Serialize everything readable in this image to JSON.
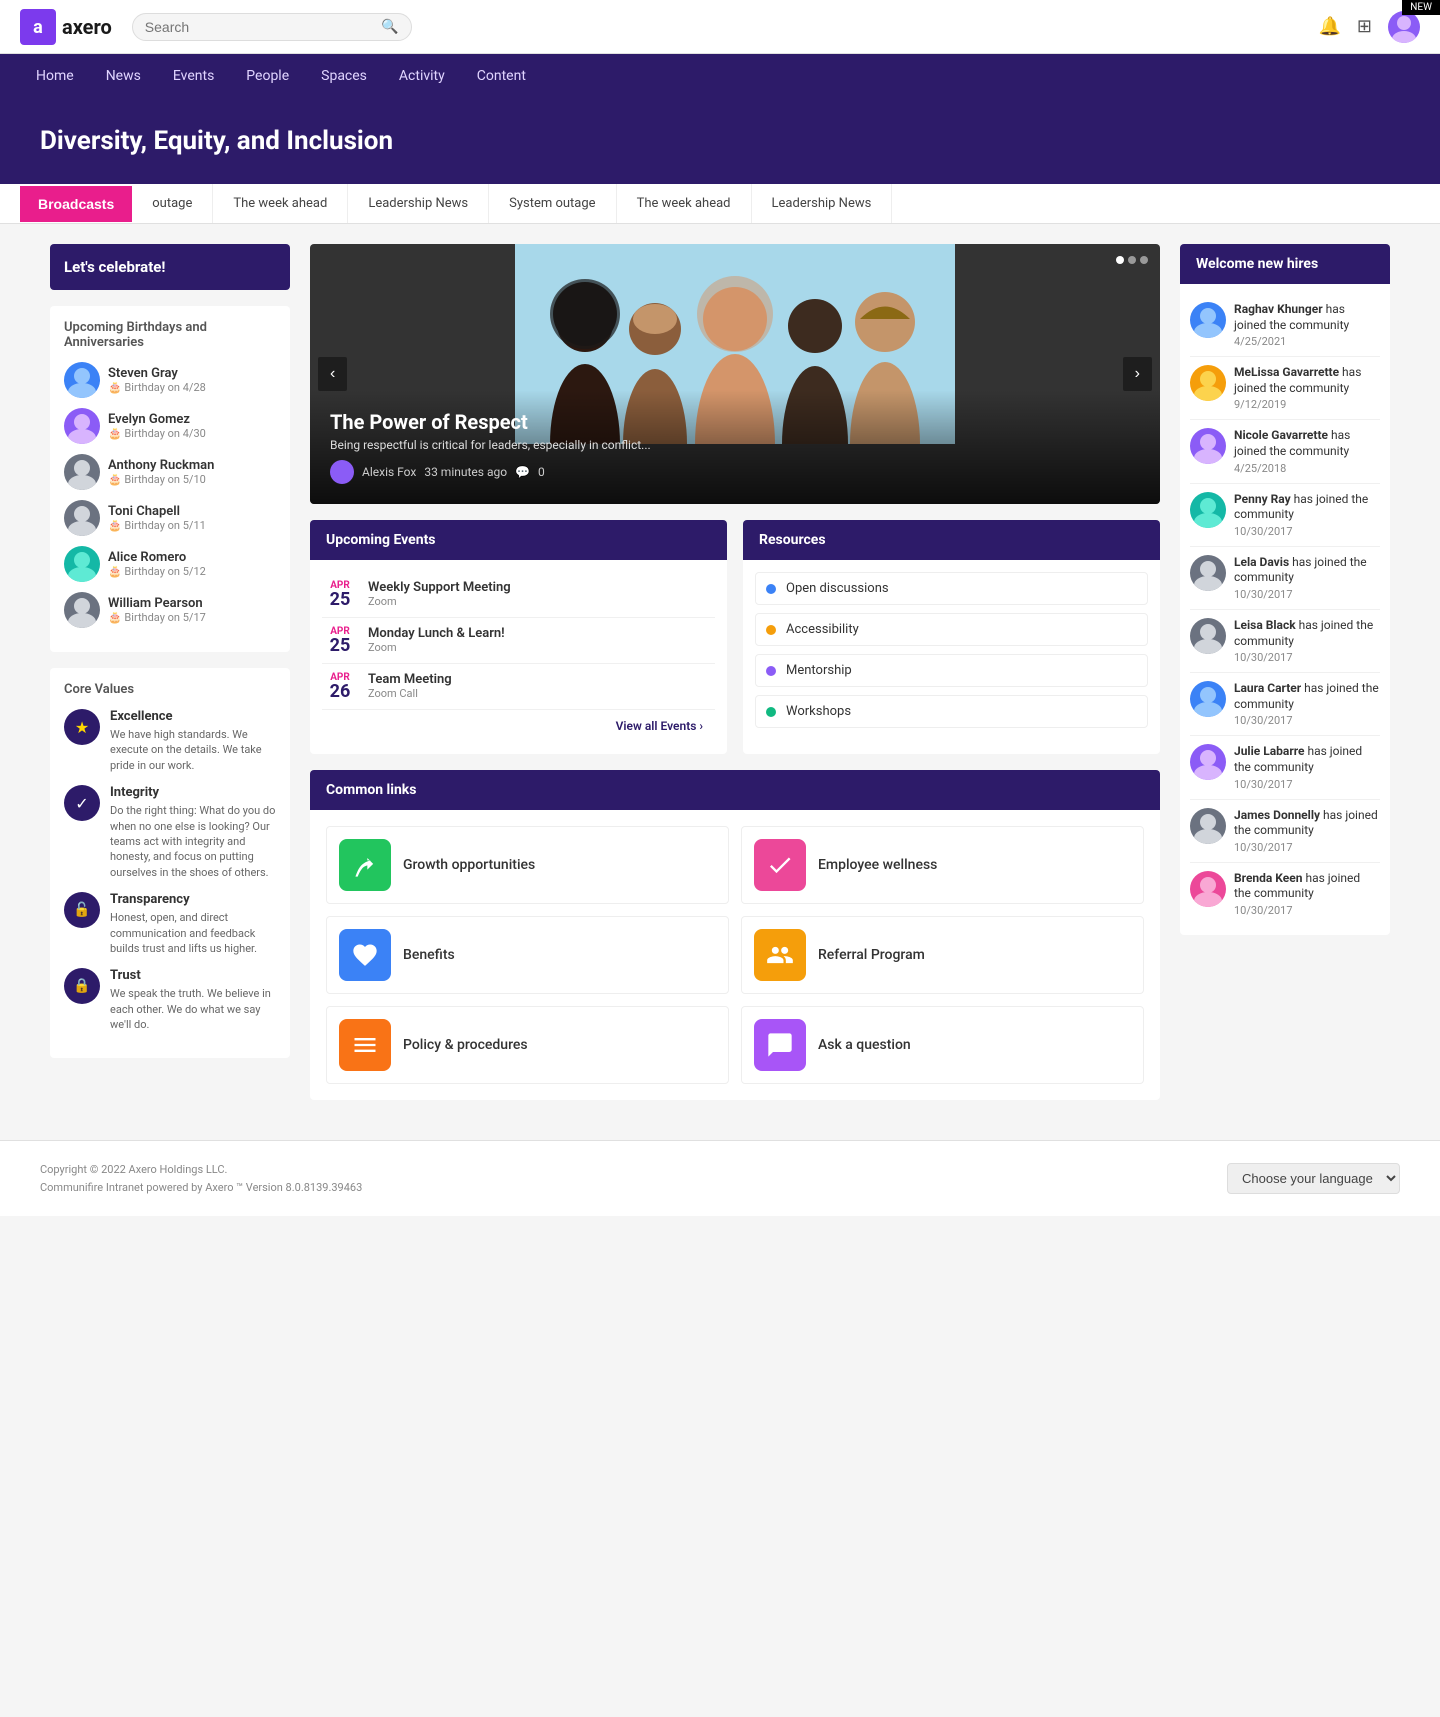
{
  "meta": {
    "corner_badge": "NEW"
  },
  "topbar": {
    "logo_text": "axero",
    "search_placeholder": "Search",
    "search_icon": "🔍"
  },
  "navbar": {
    "items": [
      {
        "label": "Home",
        "href": "#"
      },
      {
        "label": "News",
        "href": "#"
      },
      {
        "label": "Events",
        "href": "#"
      },
      {
        "label": "People",
        "href": "#"
      },
      {
        "label": "Spaces",
        "href": "#"
      },
      {
        "label": "Activity",
        "href": "#"
      },
      {
        "label": "Content",
        "href": "#"
      }
    ]
  },
  "page_header": {
    "title": "Diversity, Equity, and Inclusion"
  },
  "broadcasts_bar": {
    "button_label": "Broadcasts",
    "items": [
      {
        "label": "outage"
      },
      {
        "label": "The week ahead"
      },
      {
        "label": "Leadership News"
      },
      {
        "label": "System outage"
      },
      {
        "label": "The week ahead"
      },
      {
        "label": "Leadership News"
      }
    ]
  },
  "celebrate": {
    "title": "Let's celebrate!"
  },
  "birthdays": {
    "heading": "Upcoming Birthdays and Anniversaries",
    "items": [
      {
        "name": "Steven Gray",
        "event": "Birthday on 4/28",
        "color": "av-blue"
      },
      {
        "name": "Evelyn Gomez",
        "event": "Birthday on 4/30",
        "color": "av-purple"
      },
      {
        "name": "Anthony Ruckman",
        "event": "Birthday on 5/10",
        "color": "av-gray"
      },
      {
        "name": "Toni Chapell",
        "event": "Birthday on 5/11",
        "color": "av-gray"
      },
      {
        "name": "Alice Romero",
        "event": "Birthday on 5/12",
        "color": "av-teal"
      },
      {
        "name": "William Pearson",
        "event": "Birthday on 5/17",
        "color": "av-gray"
      }
    ]
  },
  "core_values": {
    "heading": "Core Values",
    "items": [
      {
        "title": "Excellence",
        "desc": "We have high standards. We execute on the details. We take pride in our work.",
        "icon": "★",
        "bg": "#2d1b69",
        "color": "#fff"
      },
      {
        "title": "Integrity",
        "desc": "Do the right thing: What do you do when no one else is looking? Our teams act with integrity and honesty, and focus on putting ourselves in the shoes of others.",
        "icon": "✓",
        "bg": "#2d1b69",
        "color": "#fff"
      },
      {
        "title": "Transparency",
        "desc": "Honest, open, and direct communication and feedback builds trust and lifts us higher.",
        "icon": "🔓",
        "bg": "#2d1b69",
        "color": "#fff"
      },
      {
        "title": "Trust",
        "desc": "We speak the truth. We believe in each other. We do what we say we'll do.",
        "icon": "🔒",
        "bg": "#2d1b69",
        "color": "#fff"
      }
    ]
  },
  "hero": {
    "title": "The Power of Respect",
    "subtitle": "Being respectful is critical for leaders, especially in conflict...",
    "author": "Alexis Fox",
    "time": "33 minutes ago",
    "comments": "0",
    "nav_left": "‹",
    "nav_right": "›"
  },
  "upcoming_events": {
    "heading": "Upcoming Events",
    "items": [
      {
        "month": "APR",
        "day": "25",
        "title": "Weekly Support Meeting",
        "location": "Zoom"
      },
      {
        "month": "APR",
        "day": "25",
        "title": "Monday Lunch & Learn!",
        "location": "Zoom"
      },
      {
        "month": "APR",
        "day": "26",
        "title": "Team Meeting",
        "location": "Zoom Call"
      }
    ],
    "view_all_label": "View all Events ›"
  },
  "resources": {
    "heading": "Resources",
    "items": [
      {
        "label": "Open discussions",
        "color": "#3B82F6"
      },
      {
        "label": "Accessibility",
        "color": "#F59E0B"
      },
      {
        "label": "Mentorship",
        "color": "#8B5CF6"
      },
      {
        "label": "Workshops",
        "color": "#10B981"
      }
    ]
  },
  "common_links": {
    "heading": "Common links",
    "items": [
      {
        "label": "Growth opportunities",
        "icon": "🌿",
        "bg": "#22C55E"
      },
      {
        "label": "Employee wellness",
        "icon": "✔",
        "bg": "#EC4899"
      },
      {
        "label": "Benefits",
        "icon": "❤",
        "bg": "#3B82F6"
      },
      {
        "label": "Referral Program",
        "icon": "👥",
        "bg": "#F59E0B"
      },
      {
        "label": "Policy & procedures",
        "icon": "☰",
        "bg": "#F97316"
      },
      {
        "label": "Ask a question",
        "icon": "💬",
        "bg": "#A855F7"
      }
    ]
  },
  "welcome_hires": {
    "heading": "Welcome new hires",
    "items": [
      {
        "name": "Raghav Khunger",
        "action": "has joined the community",
        "date": "4/25/2021",
        "color": "av-blue"
      },
      {
        "name": "MeLissa Gavarrette",
        "action": "has joined the community",
        "date": "9/12/2019",
        "color": "av-orange"
      },
      {
        "name": "Nicole Gavarrette",
        "action": "has joined the community",
        "date": "4/25/2018",
        "color": "av-purple"
      },
      {
        "name": "Penny Ray",
        "action": "has joined the community",
        "date": "10/30/2017",
        "color": "av-teal"
      },
      {
        "name": "Lela Davis",
        "action": "has joined the community",
        "date": "10/30/2017",
        "color": "av-gray"
      },
      {
        "name": "Leisa Black",
        "action": "has joined the community",
        "date": "10/30/2017",
        "color": "av-gray"
      },
      {
        "name": "Laura Carter",
        "action": "has joined the community",
        "date": "10/30/2017",
        "color": "av-blue"
      },
      {
        "name": "Julie Labarre",
        "action": "has joined the community",
        "date": "10/30/2017",
        "color": "av-purple"
      },
      {
        "name": "James Donnelly",
        "action": "has joined the community",
        "date": "10/30/2017",
        "color": "av-gray"
      },
      {
        "name": "Brenda Keen",
        "action": "has joined the community",
        "date": "10/30/2017",
        "color": "av-pink"
      }
    ]
  },
  "footer": {
    "copyright": "Copyright © 2022 Axero Holdings LLC.",
    "powered_by": "Communifire Intranet powered by Axero ™ Version 8.0.8139.39463",
    "language_label": "Choose your language"
  }
}
